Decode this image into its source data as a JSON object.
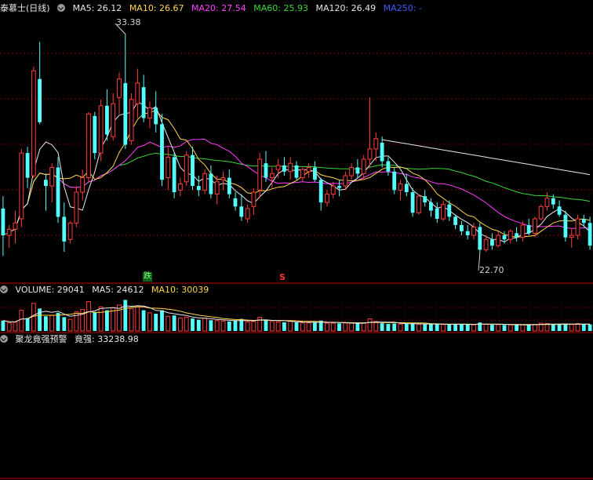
{
  "header_price": {
    "name": "泰慕士(日线)",
    "items": [
      {
        "label": "MA5: 26.12",
        "color": "#e8e8e8"
      },
      {
        "label": "MA10: 26.67",
        "color": "#ffd84a"
      },
      {
        "label": "MA20: 27.54",
        "color": "#ff40ff"
      },
      {
        "label": "MA60: 25.93",
        "color": "#3ad83a"
      },
      {
        "label": "MA120: 26.49",
        "color": "#e8e8e8"
      },
      {
        "label": "MA250: -",
        "color": "#3f5bff"
      }
    ]
  },
  "header_volume": {
    "items": [
      {
        "label": "VOLUME: 29041",
        "color": "#e8e8e8"
      },
      {
        "label": "MA5: 24612",
        "color": "#e8e8e8"
      },
      {
        "label": "MA10: 30039",
        "color": "#ffd84a"
      }
    ]
  },
  "header_indicator": {
    "items": [
      {
        "label": "聚龙竟强预警",
        "color": "#e8e8e8"
      },
      {
        "label": "竟强: 33238.98",
        "color": "#e8e8e8"
      }
    ]
  },
  "annotations": {
    "high_label": "33.38",
    "low_label": "22.70",
    "signal_down": "跌",
    "signal_s": "S"
  },
  "colors": {
    "up": "#ff3c3c",
    "down": "#54ffff",
    "ma5": "#e8e8e8",
    "ma10": "#ffd84a",
    "ma20": "#ff40ff",
    "ma60": "#3ad83a",
    "ma120": "#e8e8e8",
    "grid": "#7a0000",
    "divider": "#c00000"
  },
  "chart_data": {
    "type": "candlestick",
    "ylim": [
      22.0,
      34.2
    ],
    "candles": [
      [
        24.9,
        25.5,
        22.6,
        23.6
      ],
      [
        23.6,
        24.1,
        23.0,
        23.9
      ],
      [
        23.9,
        24.8,
        23.2,
        24.2
      ],
      [
        24.4,
        27.8,
        24.0,
        27.6
      ],
      [
        27.6,
        27.9,
        25.9,
        26.4
      ],
      [
        26.5,
        31.8,
        26.4,
        31.6
      ],
      [
        31.2,
        33.0,
        29.0,
        29.1
      ],
      [
        26.3,
        26.6,
        24.8,
        26.0
      ],
      [
        26.0,
        27.1,
        25.2,
        26.9
      ],
      [
        26.9,
        27.4,
        24.2,
        24.5
      ],
      [
        24.5,
        25.2,
        22.8,
        23.3
      ],
      [
        23.4,
        24.3,
        23.2,
        24.2
      ],
      [
        24.2,
        26.0,
        24.0,
        25.7
      ],
      [
        25.7,
        26.8,
        25.3,
        26.4
      ],
      [
        26.4,
        29.6,
        26.2,
        29.5
      ],
      [
        29.4,
        29.6,
        27.3,
        27.6
      ],
      [
        27.6,
        30.2,
        27.2,
        29.9
      ],
      [
        29.9,
        30.7,
        28.2,
        28.5
      ],
      [
        28.4,
        30.5,
        28.2,
        30.0
      ],
      [
        30.3,
        31.5,
        29.5,
        31.2
      ],
      [
        31.0,
        33.4,
        27.8,
        28.0
      ],
      [
        28.2,
        30.5,
        28.0,
        30.2
      ],
      [
        30.0,
        31.7,
        29.3,
        31.0
      ],
      [
        30.8,
        31.4,
        29.1,
        29.3
      ],
      [
        29.3,
        30.1,
        28.8,
        29.8
      ],
      [
        29.8,
        30.6,
        28.6,
        29.0
      ],
      [
        29.0,
        29.5,
        26.0,
        26.3
      ],
      [
        26.4,
        27.9,
        25.8,
        27.4
      ],
      [
        27.4,
        27.6,
        25.4,
        25.7
      ],
      [
        25.8,
        26.4,
        25.5,
        26.1
      ],
      [
        26.2,
        27.7,
        26.0,
        27.5
      ],
      [
        27.5,
        27.9,
        25.8,
        26.0
      ],
      [
        26.0,
        26.5,
        25.5,
        25.8
      ],
      [
        25.8,
        26.8,
        25.6,
        26.6
      ],
      [
        26.6,
        27.0,
        25.4,
        25.6
      ],
      [
        25.6,
        26.5,
        25.1,
        26.2
      ],
      [
        26.3,
        26.7,
        25.8,
        26.4
      ],
      [
        26.4,
        26.8,
        25.4,
        25.6
      ],
      [
        25.4,
        25.7,
        24.8,
        25.0
      ],
      [
        25.0,
        25.6,
        24.3,
        24.5
      ],
      [
        24.4,
        25.1,
        24.2,
        24.9
      ],
      [
        25.0,
        25.9,
        24.6,
        25.7
      ],
      [
        25.8,
        27.6,
        25.4,
        27.3
      ],
      [
        27.1,
        27.7,
        26.2,
        26.4
      ],
      [
        26.4,
        26.9,
        25.9,
        26.6
      ],
      [
        26.8,
        27.3,
        26.4,
        27.0
      ],
      [
        27.0,
        27.4,
        26.5,
        26.7
      ],
      [
        26.7,
        27.4,
        26.3,
        27.1
      ],
      [
        27.0,
        27.2,
        26.3,
        26.4
      ],
      [
        26.4,
        26.9,
        26.2,
        26.8
      ],
      [
        26.7,
        27.1,
        26.4,
        26.9
      ],
      [
        26.9,
        27.2,
        26.2,
        26.3
      ],
      [
        26.3,
        26.4,
        24.8,
        25.2
      ],
      [
        25.2,
        25.8,
        25.0,
        25.6
      ],
      [
        25.6,
        26.2,
        25.4,
        26.0
      ],
      [
        26.0,
        26.3,
        25.5,
        25.9
      ],
      [
        26.0,
        26.7,
        25.8,
        26.5
      ],
      [
        26.5,
        27.1,
        26.3,
        26.9
      ],
      [
        26.9,
        27.3,
        26.4,
        26.6
      ],
      [
        26.6,
        27.5,
        26.3,
        27.3
      ],
      [
        27.3,
        30.3,
        26.9,
        27.8
      ],
      [
        27.8,
        28.6,
        27.2,
        28.3
      ],
      [
        28.1,
        28.4,
        26.9,
        27.2
      ],
      [
        27.2,
        27.4,
        26.5,
        26.7
      ],
      [
        26.7,
        26.9,
        25.6,
        25.8
      ],
      [
        25.8,
        26.3,
        25.3,
        26.1
      ],
      [
        26.1,
        26.6,
        25.5,
        25.7
      ],
      [
        25.7,
        25.9,
        24.5,
        24.7
      ],
      [
        24.7,
        25.6,
        24.6,
        25.5
      ],
      [
        25.5,
        25.8,
        25.0,
        25.2
      ],
      [
        25.2,
        25.4,
        24.5,
        24.8
      ],
      [
        24.9,
        25.2,
        24.2,
        24.4
      ],
      [
        24.4,
        25.3,
        24.3,
        25.1
      ],
      [
        25.1,
        25.3,
        24.3,
        24.5
      ],
      [
        24.5,
        24.6,
        23.9,
        24.1
      ],
      [
        24.1,
        24.3,
        23.6,
        23.8
      ],
      [
        23.8,
        24.1,
        23.4,
        23.6
      ],
      [
        23.6,
        24.2,
        23.4,
        24.0
      ],
      [
        24.0,
        24.2,
        22.7,
        22.9
      ],
      [
        22.9,
        23.6,
        22.8,
        23.4
      ],
      [
        23.4,
        23.7,
        22.9,
        23.1
      ],
      [
        23.1,
        23.8,
        23.0,
        23.6
      ],
      [
        23.6,
        23.8,
        23.2,
        23.4
      ],
      [
        23.4,
        23.9,
        23.2,
        23.8
      ],
      [
        23.7,
        24.0,
        23.3,
        23.5
      ],
      [
        23.5,
        24.3,
        23.3,
        24.1
      ],
      [
        24.1,
        24.4,
        23.6,
        23.7
      ],
      [
        23.7,
        24.5,
        23.5,
        24.4
      ],
      [
        24.4,
        25.1,
        24.3,
        25.0
      ],
      [
        25.0,
        25.7,
        24.8,
        25.4
      ],
      [
        25.4,
        25.6,
        24.9,
        25.1
      ],
      [
        25.0,
        25.3,
        24.5,
        24.6
      ],
      [
        24.6,
        24.8,
        23.3,
        23.5
      ],
      [
        23.5,
        23.9,
        23.0,
        23.6
      ],
      [
        23.6,
        24.6,
        23.4,
        24.4
      ],
      [
        24.4,
        24.6,
        24.0,
        24.2
      ],
      [
        24.2,
        24.5,
        22.9,
        23.1
      ]
    ],
    "volume": [
      12000,
      9500,
      10200,
      24000,
      15000,
      32000,
      26000,
      17000,
      18000,
      21000,
      16000,
      13500,
      22000,
      25000,
      34000,
      22000,
      28000,
      24000,
      27000,
      30000,
      36000,
      26000,
      28000,
      24000,
      21000,
      20000,
      24000,
      17000,
      18000,
      15000,
      16000,
      14500,
      13000,
      15000,
      12500,
      12000,
      11500,
      11000,
      12500,
      14000,
      10500,
      11000,
      16000,
      13000,
      11000,
      10500,
      10000,
      11500,
      10000,
      9500,
      9500,
      10000,
      12000,
      9000,
      9000,
      8800,
      9200,
      9400,
      8800,
      9000,
      14000,
      11000,
      9000,
      8200,
      8600,
      8000,
      8200,
      9000,
      7800,
      7600,
      7800,
      8400,
      7600,
      7400,
      7800,
      8000,
      7400,
      7200,
      9800,
      7800,
      7200,
      7400,
      7000,
      7200,
      7000,
      7400,
      7000,
      7600,
      9000,
      8600,
      7800,
      7400,
      8000,
      7800,
      8600,
      8000,
      7600
    ]
  }
}
